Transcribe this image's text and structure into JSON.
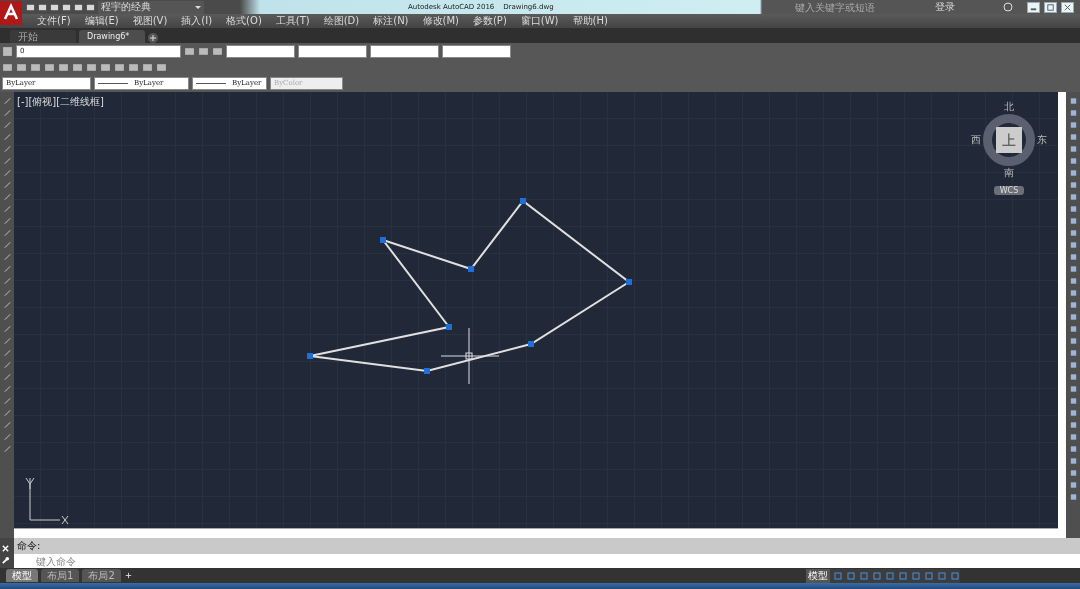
{
  "title_bar": {
    "workspace": "程宇的经典",
    "title": "Autodesk AutoCAD 2016    Drawing6.dwg",
    "search_placeholder": "键入关键字或短语",
    "sign_in": "登录"
  },
  "menu": [
    "文件(F)",
    "编辑(E)",
    "视图(V)",
    "插入(I)",
    "格式(O)",
    "工具(T)",
    "绘图(D)",
    "标注(N)",
    "修改(M)",
    "参数(P)",
    "窗口(W)",
    "帮助(H)"
  ],
  "file_tabs": [
    {
      "label": "开始",
      "selected": false
    },
    {
      "label": "Drawing6*",
      "selected": true
    }
  ],
  "layer": {
    "name": "0"
  },
  "properties": [
    {
      "kind": "color",
      "label": "ByLayer"
    },
    {
      "kind": "linetype",
      "label": "ByLayer"
    },
    {
      "kind": "lineweight",
      "label": "ByLayer"
    },
    {
      "kind": "plotstyle",
      "label": "ByColor"
    }
  ],
  "viewport": {
    "label": "[-][俯视][二维线框]",
    "compass": {
      "north": "北",
      "south": "南",
      "east": "东",
      "west": "西",
      "face": "上",
      "ucs": "WCS"
    }
  },
  "command": {
    "history": "命令:",
    "placeholder": "键入命令"
  },
  "layout_tabs": [
    {
      "label": "模型",
      "selected": true
    },
    {
      "label": "布局1",
      "selected": false
    },
    {
      "label": "布局2",
      "selected": false
    }
  ],
  "status_bar": {
    "space": "模型"
  }
}
